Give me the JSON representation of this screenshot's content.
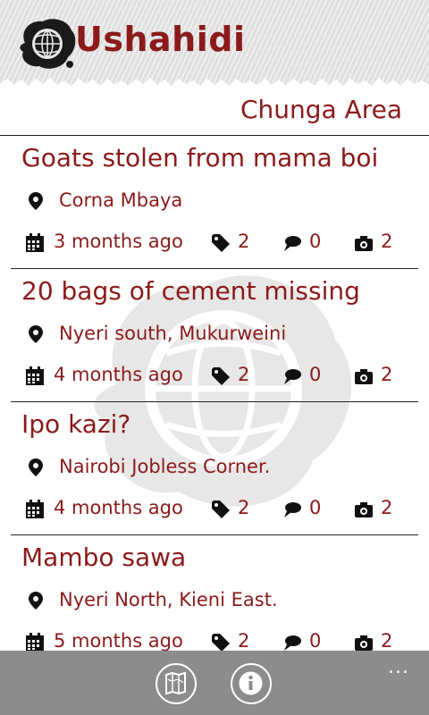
{
  "app": {
    "title": "Ushahidi"
  },
  "area": {
    "title": "Chunga Area"
  },
  "reports": [
    {
      "title": "Goats stolen from mama boi",
      "location": "Corna Mbaya",
      "age": "3 months ago",
      "categories": "2",
      "comments": "0",
      "photos": "2"
    },
    {
      "title": "20 bags of cement missing",
      "location": "Nyeri south, Mukurweini",
      "age": "4 months ago",
      "categories": "2",
      "comments": "0",
      "photos": "2"
    },
    {
      "title": "Ipo kazi?",
      "location": "Nairobi Jobless Corner.",
      "age": "4 months ago",
      "categories": "2",
      "comments": "0",
      "photos": "2"
    },
    {
      "title": "Mambo sawa",
      "location": "Nyeri North, Kieni East.",
      "age": "5 months ago",
      "categories": "2",
      "comments": "0",
      "photos": "2"
    }
  ],
  "appbar": {
    "more_label": "..."
  },
  "colors": {
    "accent": "#8b1a1a",
    "appbar": "#8c8c8c",
    "header": "#e6e6e6"
  },
  "icons": [
    "globe-logo",
    "location-pin-icon",
    "calendar-icon",
    "tag-icon",
    "comment-icon",
    "camera-icon",
    "map-icon",
    "info-icon"
  ]
}
